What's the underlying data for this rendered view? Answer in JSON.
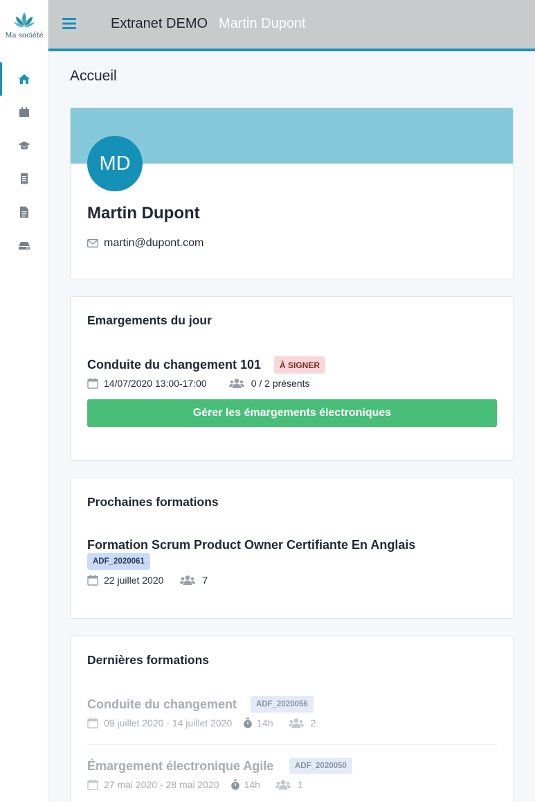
{
  "sidebar": {
    "logo_text": "Ma société",
    "items": [
      {
        "icon": "home-icon",
        "active": true
      },
      {
        "icon": "calendar-icon",
        "active": false
      },
      {
        "icon": "graduation-cap-icon",
        "active": false
      },
      {
        "icon": "receipt-icon",
        "active": false
      },
      {
        "icon": "document-icon",
        "active": false
      },
      {
        "icon": "hard-drive-icon",
        "active": false
      }
    ]
  },
  "header": {
    "brand": "Extranet DEMO",
    "user_name": "Martin Dupont"
  },
  "page": {
    "title": "Accueil"
  },
  "profile": {
    "initials": "MD",
    "name": "Martin Dupont",
    "email": "martin@dupont.com"
  },
  "emargements": {
    "title": "Emargements du jour",
    "session_title": "Conduite du changement 101",
    "status_badge": "À SIGNER",
    "datetime": "14/07/2020 13:00-17:00",
    "attendance": "0 / 2 présents",
    "button_label": "Gérer les émargements électroniques"
  },
  "prochaines": {
    "title": "Prochaines formations",
    "items": [
      {
        "title": "Formation Scrum Product Owner Certifiante En Anglais",
        "code": "ADF_2020061",
        "date": "22 juillet 2020",
        "participants": "7"
      }
    ]
  },
  "dernieres": {
    "title": "Dernières formations",
    "items": [
      {
        "title": "Conduite du changement",
        "code": "ADF_2020056",
        "dates": "09 juillet 2020 - 14 juillet 2020",
        "duration": "14h",
        "participants": "2"
      },
      {
        "title": "Émargement électronique Agile",
        "code": "ADF_2020050",
        "dates": "27 mai 2020 - 28 mai 2020",
        "duration": "14h",
        "participants": "1"
      }
    ]
  },
  "colors": {
    "accent": "#1a92b8",
    "header_bg": "#c8cbcb",
    "banner": "#86c9db",
    "success": "#48be78",
    "danger_bg": "#f8d7da"
  }
}
